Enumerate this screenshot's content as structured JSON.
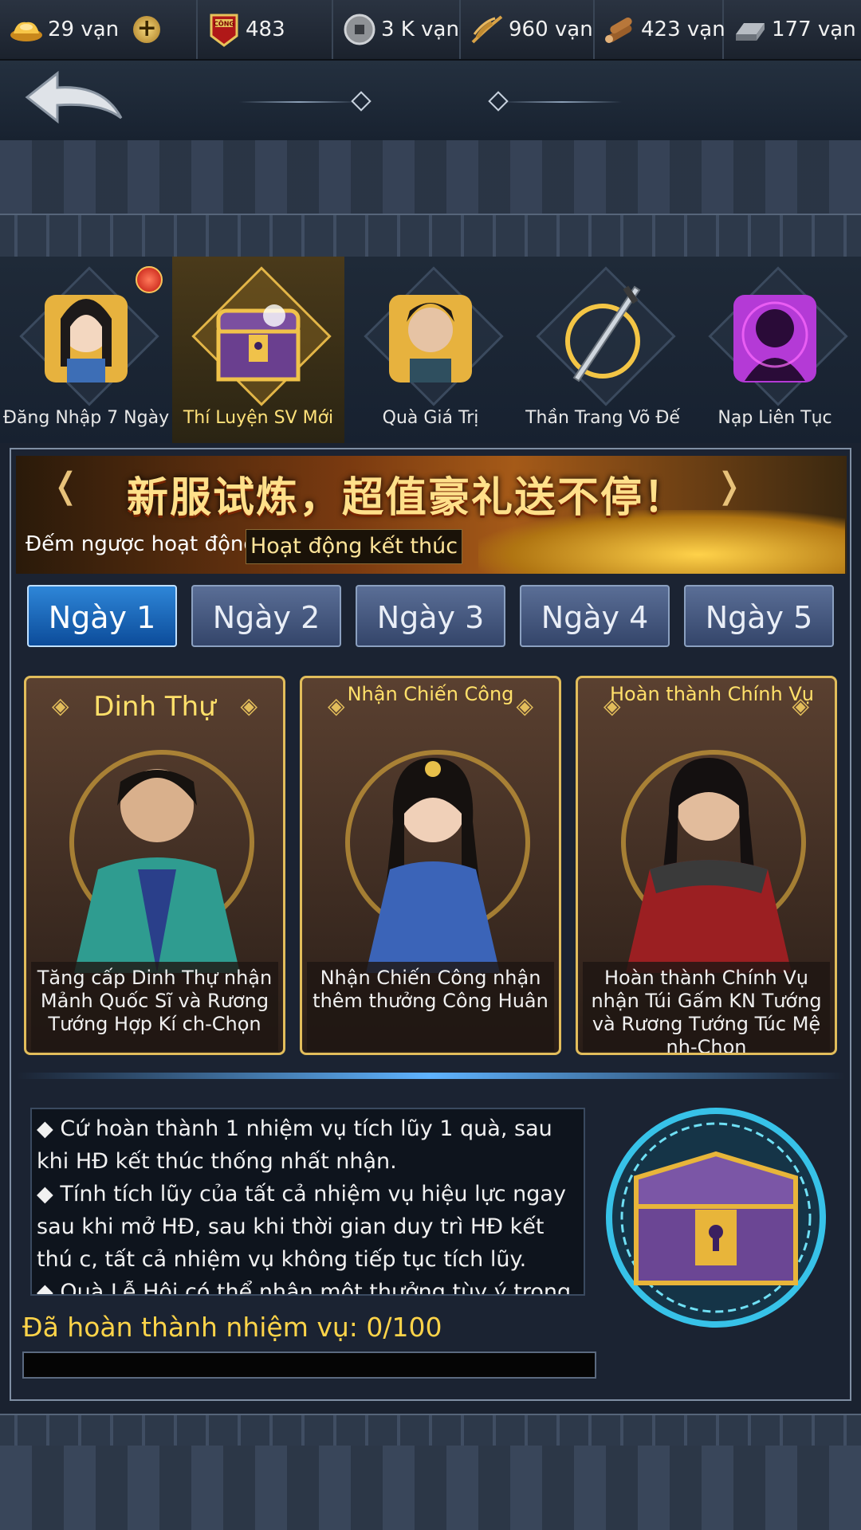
{
  "resources": [
    {
      "icon": "gold-ingot-icon",
      "value": "29 vạn",
      "has_plus": true
    },
    {
      "icon": "cong-badge-icon",
      "value": "483"
    },
    {
      "icon": "coin-icon",
      "value": "3 K vạn"
    },
    {
      "icon": "grain-icon",
      "value": "960 vạn"
    },
    {
      "icon": "wood-icon",
      "value": "423 vạn"
    },
    {
      "icon": "iron-icon",
      "value": "177 vạn"
    }
  ],
  "cong_badge_text": "CÔNG",
  "events": [
    {
      "label": "Đăng Nhập 7 Ngày",
      "icon": "beauty-puzzle-icon",
      "notification": true
    },
    {
      "label": "Thí Luyện SV Mới",
      "icon": "treasure-chest-icon",
      "active": true
    },
    {
      "label": "Quà Giá Trị",
      "icon": "scholar-puzzle-icon"
    },
    {
      "label": "Thần Trang Võ Đế",
      "icon": "sword-icon"
    },
    {
      "label": "Nạp Liên Tục",
      "icon": "purple-puzzle-icon"
    }
  ],
  "banner": {
    "title": "新服试炼，超值豪礼送不停！",
    "countdown_label": "Đếm ngược hoạt động",
    "countdown_value": "Hoạt động kết thúc"
  },
  "tabs": [
    "Ngày 1",
    "Ngày 2",
    "Ngày 3",
    "Ngày 4",
    "Ngày 5"
  ],
  "active_tab": 0,
  "cards": [
    {
      "title": "Dinh Thự",
      "two_line": false,
      "desc": "Tăng cấp Dinh Thự nhận Mảnh Quốc Sĩ và Rương Tướng Hợp Kí ch-Chọn",
      "hero": "scholar-green-robe"
    },
    {
      "title": "Nhận Chiến Công",
      "two_line": true,
      "desc": "Nhận Chiến Công nhận thêm thưởng Công Huân",
      "hero": "lady-blue-robe"
    },
    {
      "title": "Hoàn thành Chính Vụ",
      "two_line": true,
      "desc": "Hoàn thành Chính Vụ nhận Túi Gấm KN Tướng và Rương Tướng Túc Mệ nh-Chọn",
      "hero": "general-red-armor"
    }
  ],
  "info_lines": [
    "◆  Cứ hoàn thành 1 nhiệm vụ tích lũy 1 quà, sau khi HĐ kết thúc thống nhất nhận.",
    "◆  Tính tích lũy của tất cả nhiệm vụ hiệu lực ngay sau khi mở HĐ, sau khi thời gian duy trì HĐ kết thú c, tất cả nhiệm vụ không tiếp tục tích lũy.",
    "◆  Quà Lễ Hội có thể nhận một thưởng tùy ý trong"
  ],
  "progress": {
    "label": "Đã hoàn thành nhiệm vụ: 0/100",
    "fraction": 0
  },
  "colors": {
    "accent_gold": "#ffd449",
    "active_tab": "#1f74c8",
    "card_border": "#e2bd5b"
  }
}
